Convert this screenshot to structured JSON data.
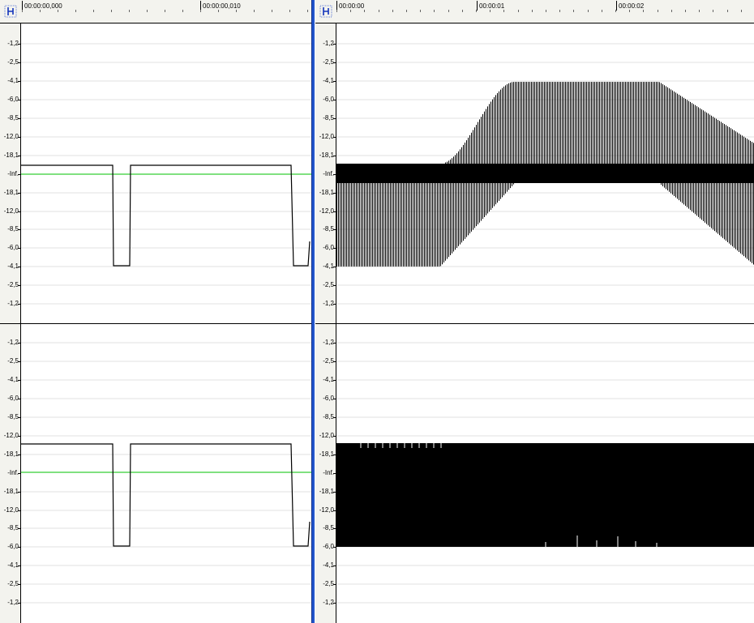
{
  "left_pane": {
    "ruler": {
      "icon": "time-ruler-icon",
      "labels": [
        "00:00:00,000",
        "00:00:00,010"
      ]
    },
    "channels": [
      {
        "name": "channel-1",
        "scale_labels": [
          "-1,2",
          "-2,5",
          "-4,1",
          "-6,0",
          "-8,5",
          "-12,0",
          "-18,1",
          "-Inf.",
          "-18,1",
          "-12,0",
          "-8,5",
          "-6,0",
          "-4,1",
          "-2,5",
          "-1,2"
        ]
      },
      {
        "name": "channel-2",
        "scale_labels": [
          "-1,2",
          "-2,5",
          "-4,1",
          "-6,0",
          "-8,5",
          "-12,0",
          "-18,1",
          "-Inf.",
          "-18,1",
          "-12,0",
          "-8,5",
          "-6,0",
          "-4,1",
          "-2,5",
          "-1,2"
        ]
      }
    ]
  },
  "right_pane": {
    "ruler": {
      "icon": "time-ruler-icon",
      "labels": [
        "00:00:00",
        "00:00:01",
        "00:00:02"
      ]
    },
    "channels": [
      {
        "name": "channel-1",
        "scale_labels": [
          "-1,2",
          "-2,5",
          "-4,1",
          "-6,0",
          "-8,5",
          "-12,0",
          "-18,1",
          "-Inf.",
          "-18,1",
          "-12,0",
          "-8,5",
          "-6,0",
          "-4,1",
          "-2,5",
          "-1,2"
        ]
      },
      {
        "name": "channel-2",
        "scale_labels": [
          "-1,2",
          "-2,5",
          "-4,1",
          "-6,0",
          "-8,5",
          "-12,0",
          "-18,1",
          "-Inf.",
          "-18,1",
          "-12,0",
          "-8,5",
          "-6,0",
          "-4,1",
          "-2,5",
          "-1,2"
        ]
      }
    ]
  },
  "colors": {
    "waveform": "#000000",
    "zero_line": "#00c000",
    "divider": "#2255cc",
    "background": "#ffffff",
    "ruler_bg": "#f3f3ee"
  }
}
